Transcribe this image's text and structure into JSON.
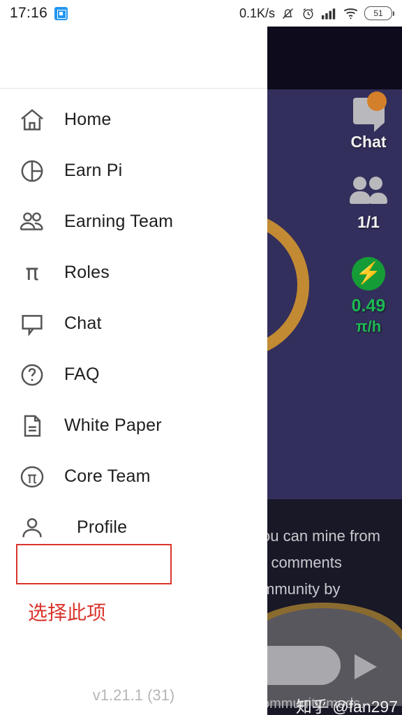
{
  "status_bar": {
    "time": "17:16",
    "app_badge_icon": "blue-app-icon",
    "network_speed": "0.1K/s",
    "icons": [
      "bell-muted-icon",
      "alarm-clock-icon",
      "signal-bars-icon",
      "wifi-icon"
    ],
    "battery_level": "51"
  },
  "drawer": {
    "menu_items": [
      {
        "label": "Home",
        "icon": "home-icon"
      },
      {
        "label": "Earn Pi",
        "icon": "pie-chart-icon"
      },
      {
        "label": "Earning Team",
        "icon": "people-icon"
      },
      {
        "label": "Roles",
        "icon": "pi-symbol-icon"
      },
      {
        "label": "Chat",
        "icon": "speech-bubble-icon"
      },
      {
        "label": "FAQ",
        "icon": "question-circle-icon"
      },
      {
        "label": "White Paper",
        "icon": "document-icon"
      },
      {
        "label": "Core Team",
        "icon": "pi-circle-icon"
      },
      {
        "label": "Profile",
        "icon": "person-icon"
      }
    ],
    "version": "v1.21.1 (31)"
  },
  "annotation": {
    "text": "选择此项",
    "color": "#d9352c",
    "target_item": "Profile"
  },
  "app_background": {
    "chat_label": "Chat",
    "chat_badge_icon": "notification-dot",
    "team_count": "1/1",
    "mining_rate": "0.49",
    "mining_rate_unit": "π/h",
    "bolt_icon": "lightning-bolt-icon",
    "overlay_lines": [
      "ou can mine from",
      "r comments",
      "mmunity by"
    ],
    "overlay_footer": "ommunity mods.",
    "send_icon": "send-arrow-icon",
    "watermark": "知乎 @fan297"
  }
}
